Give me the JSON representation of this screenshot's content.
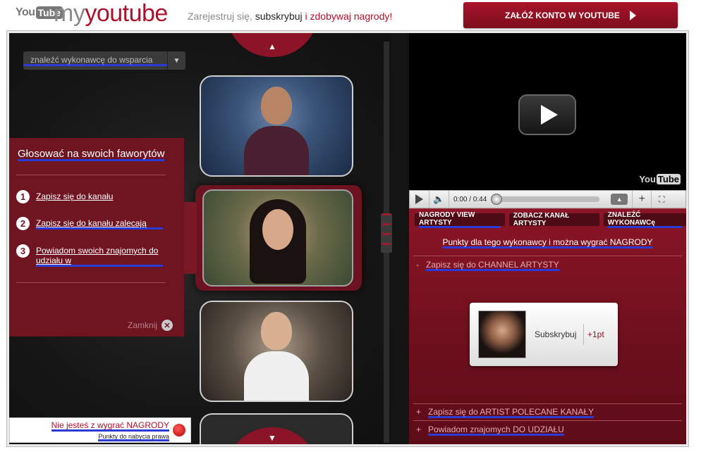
{
  "header": {
    "logo_you": "You",
    "logo_tube": "Tube",
    "brand_my": "my",
    "brand_youtube": "youtube",
    "tagline_part1": "Zarejestruj się, ",
    "tagline_part2": "subskrybuj",
    "tagline_part3": " i zdobywaj nagrody!",
    "signup_label": "ZAŁÓŻ KONTO W YOUTUBE"
  },
  "search": {
    "label": "znaleźć wykonawcę do wsparcia",
    "arrow": "▼"
  },
  "carousel": {
    "up_arrow": "▲",
    "down_arrow": "▼"
  },
  "vote_panel": {
    "title": "Głosować na swoich faworytów",
    "steps": [
      {
        "num": "1",
        "text": "Zapisz się do kanału"
      },
      {
        "num": "2",
        "text": "Zapisz się do kanału zalecają"
      },
      {
        "num": "3",
        "text": "Powiadom swoich znajomych do udziału w"
      }
    ],
    "close_label": "Zamknij",
    "close_icon": "✕"
  },
  "prize_box": {
    "line1": "Nie jesteś z wygrać NAGRODY",
    "line2": "Punkty do nabycia prawa"
  },
  "player": {
    "watermark_you": "You",
    "watermark_tube": "Tube",
    "time": "0:00 / 0:44",
    "volume_icon": "🔈",
    "up_icon": "▲",
    "plus_icon": "+",
    "fullscreen_icon": "⛶"
  },
  "rewards": {
    "tabs": [
      "NAGRODY VIEW ARTYSTY",
      "ZOBACZ KANAŁ ARTYSTY",
      "ZNALEŹĆ WYKONAWCę"
    ],
    "headline": "Punkty dla tego wykonawcy i można wygrać NAGRODY",
    "section1": {
      "sign": "-",
      "label": "Zapisz się do CHANNEL ARTYSTY"
    },
    "card": {
      "label": "Subskrybuj",
      "points": "+1pt"
    },
    "section2": {
      "sign": "+",
      "label": "Zapisz się do ARTIST POLECANE KANAŁY"
    },
    "section3": {
      "sign": "+",
      "label": "Powiadom znajomych DO UDZIAŁU"
    }
  }
}
